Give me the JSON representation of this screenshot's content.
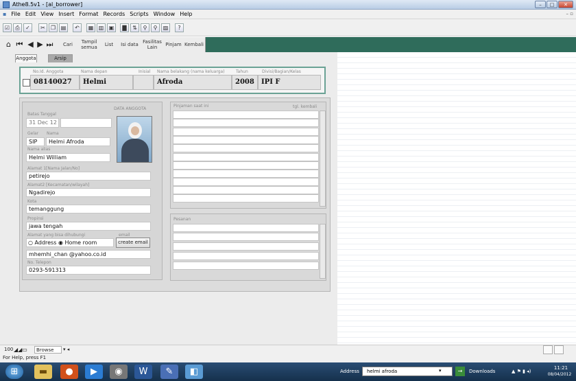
{
  "window": {
    "title": "Athe8.5v1 - [al_borrower]"
  },
  "menu": {
    "items": [
      "File",
      "Edit",
      "View",
      "Insert",
      "Format",
      "Records",
      "Scripts",
      "Window",
      "Help"
    ]
  },
  "nav": {
    "cari": "Cari",
    "tampil_semua": "Tampil semua",
    "list": "List",
    "isi_data": "Isi data",
    "fasilitas_lain": "Fasilitas Lain",
    "pinjam": "Pinjam",
    "kembali": "Kembali"
  },
  "tabs": [
    {
      "label": "Anggota"
    },
    {
      "label": "Arsip"
    }
  ],
  "header": {
    "no_id_label": "No.Id. Anggota",
    "no_id": "08140027",
    "nama_depan_label": "Nama depan",
    "nama_depan": "Helmi",
    "inisial_label": "Inisial",
    "inisial": "",
    "nama_belakang_label": "Nama belakang (nama keluarga)",
    "nama_belakang": "Afroda",
    "tahun_label": "Tahun",
    "tahun": "2008",
    "divisi_label": "Divisi/Bagian/Kelas",
    "divisi": "IPI F"
  },
  "form": {
    "section_title": "DATA ANGGOTA",
    "batas_tanggal_label": "Batas Tanggal",
    "batas_tanggal": "31 Dec 12",
    "gelar_label": "Gelar",
    "gelar": "SIP",
    "nama_label": "Nama",
    "nama": "Helmi Afroda",
    "nama_alias_label": "Nama alias",
    "nama_alias": "Helmi William",
    "alamat1_label": "Alamat 1[Nama Jalan/No]",
    "alamat1": "petirejo",
    "alamat2_label": "Alamat2 [Kecamatan/wilayah]",
    "alamat2": "Ngadirejo",
    "kota_label": "Kota",
    "kota": "temanggung",
    "propinsi_label": "Propinsi",
    "propinsi": "jawa tengah",
    "alamat_kontak_label": "Alamat yang bisa dihubungi",
    "radio_address": "Address",
    "radio_home": "Home room",
    "email_label": "email",
    "create_email": "create email",
    "email": "mhemhi_chan @yahoo.co.id",
    "telepon_label": "No. Telepon",
    "telepon": "0293-591313"
  },
  "loans": {
    "title": "Pinjaman saat ini",
    "return_label": "tgl. kembali"
  },
  "messages": {
    "title": "Pesanan"
  },
  "bottom": {
    "zoom": "100",
    "mode": "Browse"
  },
  "status": {
    "text": "For Help, press F1"
  },
  "taskbar": {
    "address_label": "Address",
    "address_value": "helmi afroda",
    "downloads": "Downloads",
    "time": "11:21",
    "date": "08/04/2012"
  },
  "colors": {
    "nav_green": "#2f6c5b",
    "header_border": "#6aa294",
    "panel": "#d6d6d6"
  }
}
